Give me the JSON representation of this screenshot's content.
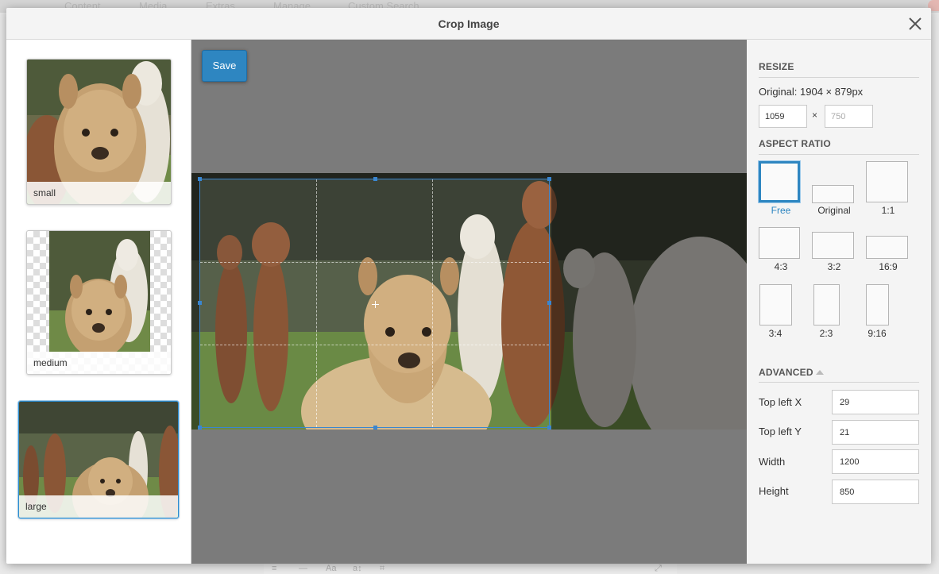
{
  "background": {
    "menu": [
      "Content",
      "Media",
      "Extras",
      "Manage",
      "Custom Search"
    ],
    "bottom_toolbar": [
      "≡",
      "—",
      "Aa",
      "a↕",
      "⌗",
      "⤢"
    ]
  },
  "modal": {
    "title": "Crop Image",
    "close_icon": "close-icon"
  },
  "thumbnails": [
    {
      "label": "small",
      "active": false
    },
    {
      "label": "medium",
      "active": false
    },
    {
      "label": "large",
      "active": true
    }
  ],
  "editor": {
    "save_label": "Save"
  },
  "resize": {
    "title": "RESIZE",
    "original": "Original: 1904 × 879px",
    "width_value": "1059",
    "height_placeholder": "750",
    "times": "×"
  },
  "aspect_ratio": {
    "title": "ASPECT RATIO",
    "options": [
      {
        "label": "Free",
        "active": true
      },
      {
        "label": "Original"
      },
      {
        "label": "1:1"
      },
      {
        "label": "4:3"
      },
      {
        "label": "3:2"
      },
      {
        "label": "16:9"
      },
      {
        "label": "3:4"
      },
      {
        "label": "2:3"
      },
      {
        "label": "9:16"
      }
    ]
  },
  "advanced": {
    "title": "ADVANCED",
    "fields": [
      {
        "label": "Top left X",
        "value": "29"
      },
      {
        "label": "Top left Y",
        "value": "21"
      },
      {
        "label": "Width",
        "value": "1200"
      },
      {
        "label": "Height",
        "value": "850"
      }
    ]
  },
  "colors": {
    "accent": "#2e86c1",
    "editor_bg": "#7b7b7b",
    "panel_bg": "#f4f4f4"
  }
}
